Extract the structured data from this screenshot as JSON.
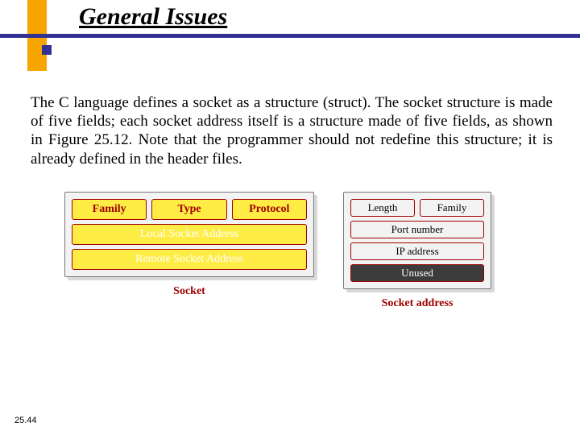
{
  "title": "General Issues",
  "body": "The C language defines a socket as a structure (struct). The socket structure is made of five fields; each socket address itself is a structure made of five fields, as shown in Figure 25.12. Note that the programmer should not redefine this structure; it is already defined in the header files.",
  "socket": {
    "caption": "Socket",
    "row1": [
      "Family",
      "Type",
      "Protocol"
    ],
    "row2": "Local Socket Address",
    "row3": "Remote Socket Address"
  },
  "socket_address": {
    "caption": "Socket address",
    "row1": [
      "Length",
      "Family"
    ],
    "row2": "Port number",
    "row3": "IP address",
    "row4": "Unused"
  },
  "page_number": "25.44"
}
